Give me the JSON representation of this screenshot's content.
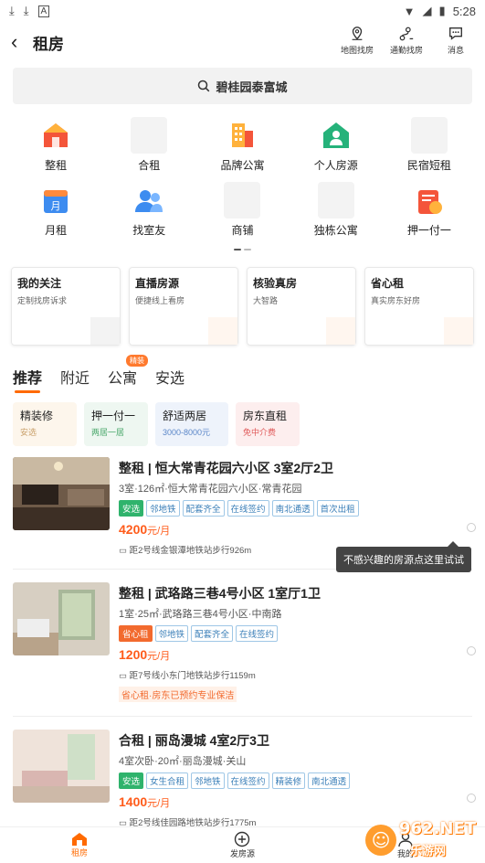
{
  "statusbar": {
    "time": "5:28",
    "icons": [
      "download-icon",
      "download-icon",
      "a-icon",
      "wifi-icon",
      "signal-icon",
      "battery-icon"
    ]
  },
  "header": {
    "title": "租房",
    "actions": [
      {
        "label": "地图找房",
        "icon": "map-pin-icon"
      },
      {
        "label": "通勤找房",
        "icon": "commute-icon"
      },
      {
        "label": "消息",
        "icon": "message-icon"
      }
    ]
  },
  "search": {
    "text": "碧桂园泰富城"
  },
  "categories": [
    {
      "label": "整租",
      "icon": "house-icon"
    },
    {
      "label": "合租",
      "icon": "placeholder-icon"
    },
    {
      "label": "品牌公寓",
      "icon": "building-icon"
    },
    {
      "label": "个人房源",
      "icon": "person-house-icon"
    },
    {
      "label": "民宿短租",
      "icon": "placeholder-icon"
    },
    {
      "label": "月租",
      "icon": "calendar-icon"
    },
    {
      "label": "找室友",
      "icon": "roommate-icon"
    },
    {
      "label": "商铺",
      "icon": "placeholder-icon"
    },
    {
      "label": "独栋公寓",
      "icon": "placeholder-icon"
    },
    {
      "label": "押一付一",
      "icon": "wallet-icon"
    }
  ],
  "promo_cards": [
    {
      "title": "我的关注",
      "subtitle": "定制找房诉求"
    },
    {
      "title": "直播房源",
      "subtitle": "便捷线上看房"
    },
    {
      "title": "核验真房",
      "subtitle": "大智路"
    },
    {
      "title": "省心租",
      "subtitle": "真实房东好房"
    }
  ],
  "tabs": [
    {
      "label": "推荐",
      "active": true
    },
    {
      "label": "附近"
    },
    {
      "label": "公寓",
      "badge": "精装"
    },
    {
      "label": "安选"
    }
  ],
  "filters": [
    {
      "title": "精装修",
      "subtitle": "安选",
      "bg": "#fdf6ec",
      "color": "#c9a06a"
    },
    {
      "title": "押一付一",
      "subtitle": "两居一居",
      "bg": "#eef7f1",
      "color": "#4aa86b"
    },
    {
      "title": "舒适两居",
      "subtitle": "3000-8000元",
      "bg": "#eef3fb",
      "color": "#5a86c8"
    },
    {
      "title": "房东直租",
      "subtitle": "免中介费",
      "bg": "#fdeeee",
      "color": "#e05a5a"
    }
  ],
  "listings": [
    {
      "title": "整租 | 恒大常青花园六小区 3室2厅2卫",
      "desc": "3室·126㎡·恒大常青花园六小区·常青花园",
      "tags": [
        {
          "text": "安选",
          "style": "green"
        },
        {
          "text": "邻地铁"
        },
        {
          "text": "配套齐全"
        },
        {
          "text": "在线签约"
        },
        {
          "text": "南北通透"
        },
        {
          "text": "首次出租"
        }
      ],
      "price": "4200",
      "price_unit": "元/月",
      "metro": "距2号线金银潭地铁站步行926m"
    },
    {
      "title": "整租 | 武珞路三巷4号小区 1室厅1卫",
      "desc": "1室·25㎡·武珞路三巷4号小区·中南路",
      "tags": [
        {
          "text": "省心租",
          "style": "orange"
        },
        {
          "text": "邻地铁"
        },
        {
          "text": "配套齐全"
        },
        {
          "text": "在线签约"
        }
      ],
      "price": "1200",
      "price_unit": "元/月",
      "metro": "距7号线小东门地铁站步行1159m",
      "note": "省心租·房东已预约专业保洁"
    },
    {
      "title": "合租 | 丽岛漫城 4室2厅3卫",
      "desc": "4室次卧·20㎡·丽岛漫城·关山",
      "tags": [
        {
          "text": "安选",
          "style": "green"
        },
        {
          "text": "女生合租"
        },
        {
          "text": "邻地铁"
        },
        {
          "text": "在线签约"
        },
        {
          "text": "精装修"
        },
        {
          "text": "南北通透"
        }
      ],
      "price": "1400",
      "price_unit": "元/月",
      "metro": "距2号线佳园路地铁站步行1775m"
    }
  ],
  "tooltip": "不感兴趣的房源点这里试试",
  "bottom_nav": [
    {
      "label": "租房",
      "active": true
    },
    {
      "label": "发房源"
    },
    {
      "label": "我的"
    }
  ],
  "watermark": {
    "main": "962.NET",
    "sub": "乐游网"
  },
  "colors": {
    "accent": "#ff6a00",
    "price": "#ff5b1a"
  }
}
